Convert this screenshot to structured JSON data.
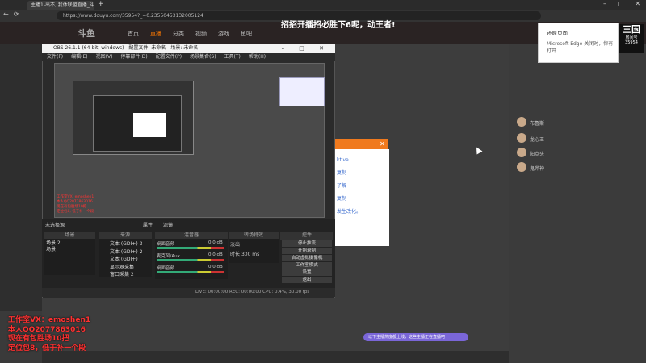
{
  "browser": {
    "tab_title": "主播1-出不, 我体联盟直播_斗鱼直",
    "url": "https://www.douyu.com/35954?_=0.23550453132005124",
    "window_title": "招招开播招必胜下6呢，动王者!"
  },
  "site": {
    "logo": "斗鱼",
    "nav": [
      "首页",
      "直播",
      "分类",
      "视频",
      "游戏",
      "鱼吧"
    ]
  },
  "obs": {
    "title": "OBS 26.1.1 (64-bit, windows) - 配置文件: 未命名 - 场景: 未命名",
    "menu": [
      "文件(F)",
      "编辑(E)",
      "视图(V)",
      "停靠部件(D)",
      "配置文件(P)",
      "场景集合(S)",
      "工具(T)",
      "帮助(H)"
    ],
    "selected_source": "未选择源",
    "attr_tab": "属性",
    "filter_tab": "滤镜",
    "headers": {
      "scenes": "场景",
      "sources": "来源",
      "mixer": "混音器",
      "transitions": "转场特效",
      "controls": "控件"
    },
    "scenes": [
      "场景 2",
      "场景"
    ],
    "sources": [
      "文本 (GDI+) 3",
      "文本 (GDI+) 2",
      "文本 (GDI+)",
      "显示器采集",
      "窗口采集 2"
    ],
    "mixer": [
      {
        "name": "桌面音频",
        "db": "0.0 dB"
      },
      {
        "name": "麦克风/Aux",
        "db": "0.0 dB"
      },
      {
        "name": "桌面音频",
        "db": "0.0 dB"
      }
    ],
    "transition": {
      "type": "淡出",
      "duration_label": "时长",
      "duration": "300 ms"
    },
    "controls": [
      "停止推流",
      "开始录制",
      "启动虚拟摄像机",
      "工作室模式",
      "设置",
      "退出"
    ],
    "status": "LIVE: 00:00:00   REC: 00:00:00   CPU: 0.4%, 30.00 fps"
  },
  "nested": {
    "red_lines": [
      "工作室VX: emoshen1",
      "本人QQ2077863016",
      "现在有包胜场10把",
      "定位包8, 低于补一个段"
    ]
  },
  "popup": {
    "lines": [
      "ktive",
      "复制",
      "了解",
      "复制",
      "发生改化。"
    ]
  },
  "overlay": {
    "lines": [
      "工作室VX：emoshen1",
      "本人QQ2077863016",
      "现在有包胜场10把",
      "定位包8，低于补一个段"
    ]
  },
  "edge_popup": {
    "title": "还原页面",
    "desc": "Microsoft Edge 关闭时，你有打开"
  },
  "promo": {
    "logo": "三国",
    "sub": "房间号",
    "room": "35954"
  },
  "chat": [
    "布鲁斯",
    "龙心王",
    "阳点头",
    "鬼斧神"
  ],
  "bottom_notice": "以下主播热度都上线，这些主播正在直播吧"
}
